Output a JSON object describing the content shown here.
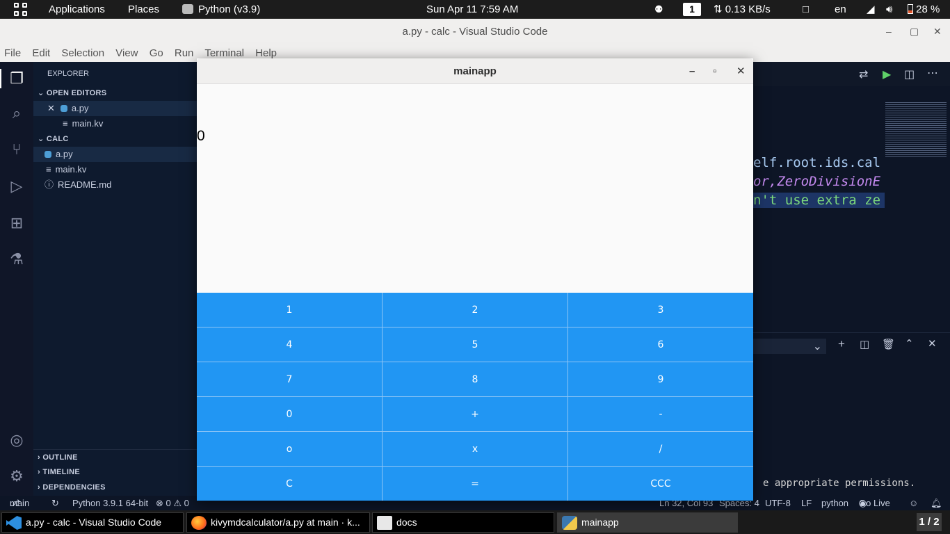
{
  "topbar": {
    "applications": "Applications",
    "places": "Places",
    "python_app": "Python (v3.9)",
    "datetime": "Sun Apr 11  7:59 AM",
    "workspace": "1",
    "net_speed": "0.13 KB/s",
    "language": "en",
    "battery": "28 %"
  },
  "vscode": {
    "window_title": "a.py - calc - Visual Studio Code",
    "menu": [
      "File",
      "Edit",
      "Selection",
      "View",
      "Go",
      "Run",
      "Terminal",
      "Help"
    ],
    "explorer_label": "EXPLORER",
    "open_editors_label": "OPEN EDITORS",
    "open_editors": [
      "a.py",
      "main.kv"
    ],
    "folder_label": "CALC",
    "files": [
      "a.py",
      "main.kv",
      "README.md"
    ],
    "outline_label": "OUTLINE",
    "timeline_label": "TIMELINE",
    "dependencies_label": "DEPENDENCIES",
    "code_lines": [
      "elf.root.ids.cal",
      "or,ZeroDivisionE",
      "n't use extra ze"
    ],
    "terminal_text": "e appropriate permissions.",
    "status": {
      "branch": "main",
      "interpreter": "Python 3.9.1 64-bit",
      "problems": "⊗ 0 ⚠ 0",
      "position": "Ln 32, Col 93",
      "spaces": "Spaces: 4",
      "encoding": "UTF-8",
      "eol": "LF",
      "language": "python",
      "golive": "Go Live"
    }
  },
  "mainapp": {
    "title": "mainapp",
    "display_value": "0",
    "keys": [
      "1",
      "2",
      "3",
      "4",
      "5",
      "6",
      "7",
      "8",
      "9",
      "0",
      "+",
      "-",
      "o",
      "x",
      "/",
      "C",
      "=",
      "CCC"
    ]
  },
  "taskbar": {
    "tasks": [
      "a.py - calc - Visual Studio Code",
      "kivymdcalculator/a.py at main · k...",
      "docs",
      "mainapp"
    ],
    "pager": "1 / 2"
  }
}
